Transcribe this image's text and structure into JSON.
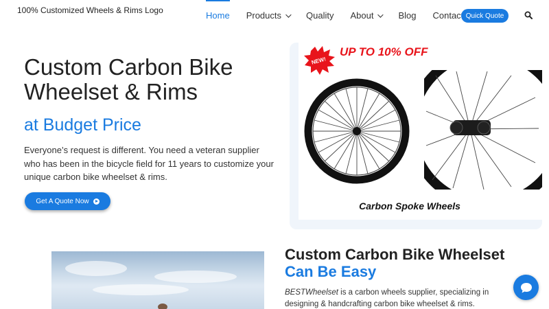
{
  "header": {
    "logo": "100% Customized Wheels & Rims Logo",
    "nav": [
      {
        "label": "Home"
      },
      {
        "label": "Products"
      },
      {
        "label": "Quality"
      },
      {
        "label": "About"
      },
      {
        "label": "Blog"
      },
      {
        "label": "Contact"
      }
    ],
    "quote_button": "Quick Quote"
  },
  "hero": {
    "title": "Custom Carbon Bike Wheelset & Rims",
    "subtitle": "at Budget Price",
    "text": "Everyone’s request is different. You need a veteran supplier who has been in the bicycle field for 11 years to customize your unique carbon bike wheelset & rims.",
    "cta": "Get A Quote Now",
    "promo": {
      "badge": "NEW!",
      "banner": "UP TO 10% OFF",
      "caption": "Carbon Spoke Wheels"
    }
  },
  "section2": {
    "title_main": "Custom Carbon Bike Wheelset ",
    "title_highlight": "Can Be Easy",
    "brand": "BESTWheelset",
    "text": " is a carbon wheels supplier, specializing in designing & handcrafting carbon bike wheelset & rims."
  },
  "colors": {
    "accent": "#1a7be0",
    "promo_red": "#e8141b"
  }
}
